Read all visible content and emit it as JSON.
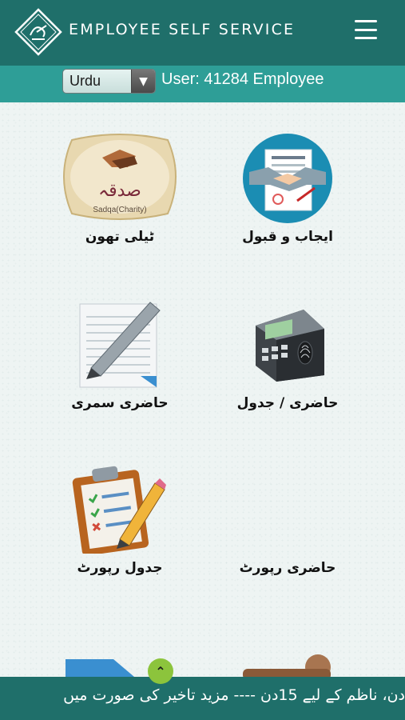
{
  "header": {
    "title": "EMPLOYEE SELF SERVICE"
  },
  "subbar": {
    "language": "Urdu",
    "user": "User: 41284 Employee"
  },
  "tiles": [
    {
      "label": "ایجاب و قبول",
      "icon": "handshake-contract-icon"
    },
    {
      "label": "ٹیلی تھون",
      "icon": "sadqa-charity-icon",
      "icon_caption": "Sadqa(Charity)",
      "icon_title": "صدقہ"
    },
    {
      "label": "حاضری / جدول",
      "icon": "biometric-attendance-machine-icon"
    },
    {
      "label": "حاضری سمری",
      "icon": "notepad-pen-icon"
    },
    {
      "label": "حاضری رپورٹ",
      "icon": ""
    },
    {
      "label": "جدول رپورٹ",
      "icon": "clipboard-checklist-icon"
    }
  ],
  "ticker": {
    "text": "دن، ناظم کے لیے 15دن ---- مزید تاخیر کی صورت میں"
  },
  "colors": {
    "header": "#1f6f6a",
    "subbar": "#2e9e97",
    "scroll_button": "#8cc43c"
  }
}
